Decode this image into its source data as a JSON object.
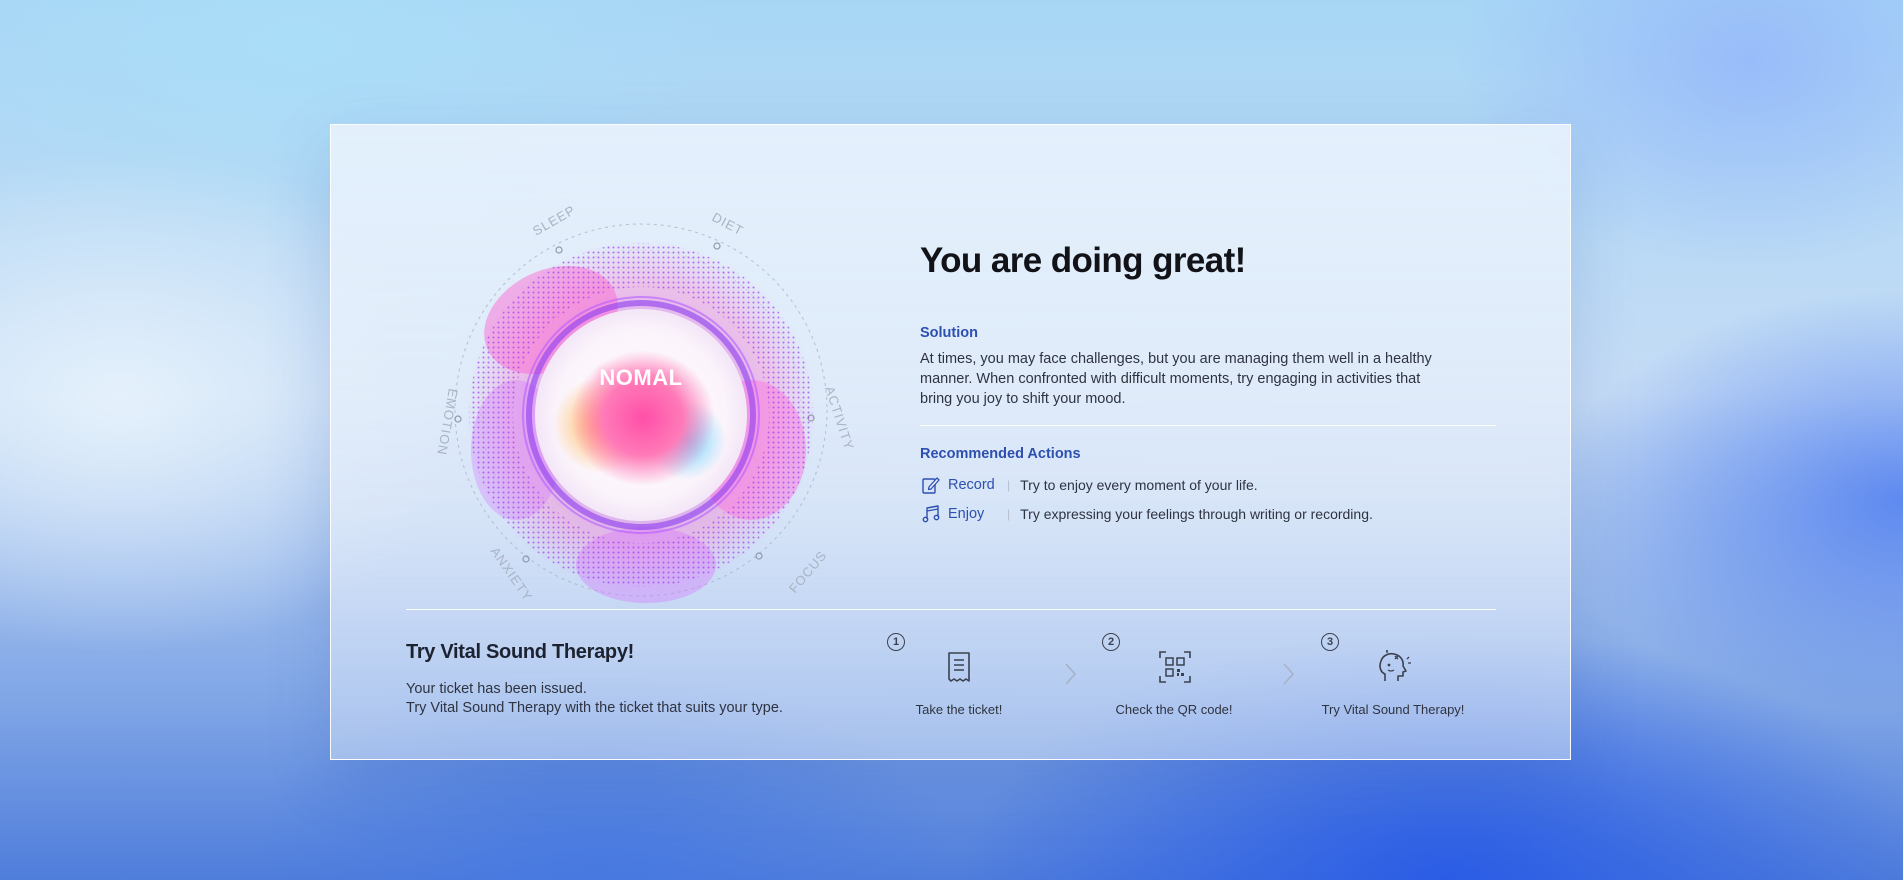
{
  "card": {
    "orb": {
      "center_label": "NOMAL",
      "ring_labels": {
        "sleep": "SLEEP",
        "diet": "DIET",
        "activity": "ACTIVITY",
        "focus": "FOCUS",
        "anxiety": "ANXIETY",
        "emotion": "EMOTION"
      }
    },
    "headline": "You are doing great!",
    "solution": {
      "title": "Solution",
      "text": "At times, you may face challenges, but you are managing them well in a healthy manner. When confronted with difficult moments, try engaging in activities that bring you joy to shift your mood."
    },
    "recommended": {
      "title": "Recommended Actions",
      "items": [
        {
          "name": "Record",
          "icon": "edit-icon",
          "separator": "|",
          "description": "Try to enjoy every moment of your life."
        },
        {
          "name": "Enjoy",
          "icon": "music-note-icon",
          "separator": "|",
          "description": "Try expressing your feelings through writing or recording."
        }
      ]
    },
    "therapy": {
      "title": "Try Vital Sound Therapy!",
      "line1": "Your ticket has been issued.",
      "line2": "Try Vital Sound Therapy with the ticket that suits your type.",
      "steps": [
        {
          "number": "1",
          "icon": "receipt-icon",
          "label": "Take the ticket!"
        },
        {
          "number": "2",
          "icon": "qr-code-icon",
          "label": "Check the QR code!"
        },
        {
          "number": "3",
          "icon": "head-sound-icon",
          "label": "Try Vital Sound Therapy!"
        }
      ]
    }
  },
  "colors": {
    "accent": "#2d4fb0",
    "headline": "#111318",
    "orb_pink": "#ff4fa8",
    "orb_purple": "#8b3cf0",
    "orb_orange": "#ffb347"
  }
}
